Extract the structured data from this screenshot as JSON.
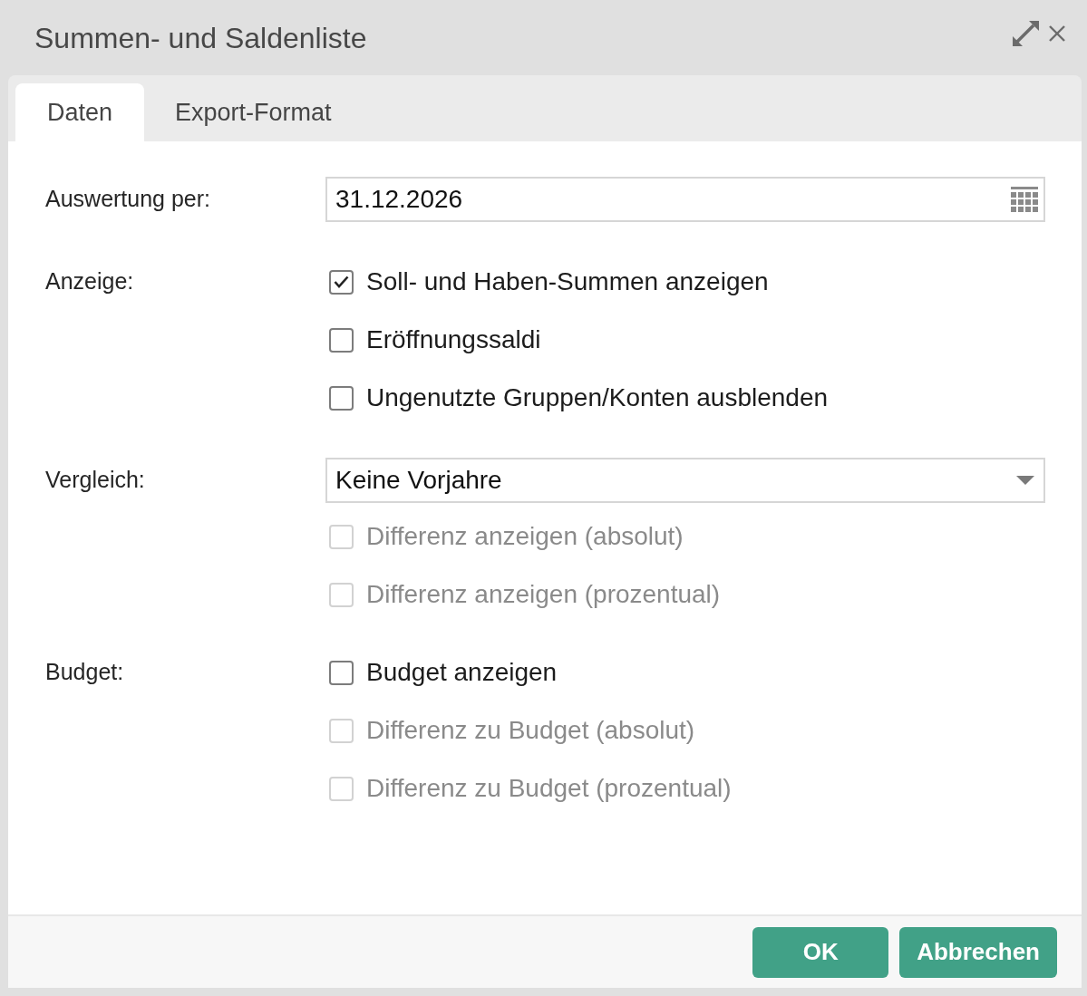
{
  "window": {
    "title": "Summen- und Saldenliste"
  },
  "tabs": [
    {
      "label": "Daten",
      "selected": true
    },
    {
      "label": "Export-Format",
      "selected": false
    }
  ],
  "form": [
    {
      "label": "Auswertung per:",
      "kind": "date",
      "value": "31.12.2026"
    },
    {
      "label": "Anzeige:",
      "kind": "checkboxes",
      "checkboxes": [
        {
          "label": "Soll- und Haben-Summen anzeigen",
          "checked": true,
          "disabled": false
        },
        {
          "label": "Eröffnungssaldi",
          "checked": false,
          "disabled": false
        },
        {
          "label": "Ungenutzte Gruppen/Konten ausblenden",
          "checked": false,
          "disabled": false
        }
      ]
    },
    {
      "label": "Vergleich:",
      "kind": "select",
      "value": "Keine Vorjahre",
      "checkboxes": [
        {
          "label": "Differenz anzeigen (absolut)",
          "checked": false,
          "disabled": true
        },
        {
          "label": "Differenz anzeigen (prozentual)",
          "checked": false,
          "disabled": true
        }
      ]
    },
    {
      "label": "Budget:",
      "kind": "checkboxes",
      "checkboxes": [
        {
          "label": "Budget anzeigen",
          "checked": false,
          "disabled": false
        },
        {
          "label": "Differenz zu Budget (absolut)",
          "checked": false,
          "disabled": true
        },
        {
          "label": "Differenz zu Budget (prozentual)",
          "checked": false,
          "disabled": true
        }
      ]
    }
  ],
  "buttons": [
    {
      "label": "OK"
    },
    {
      "label": "Abbrechen"
    }
  ]
}
